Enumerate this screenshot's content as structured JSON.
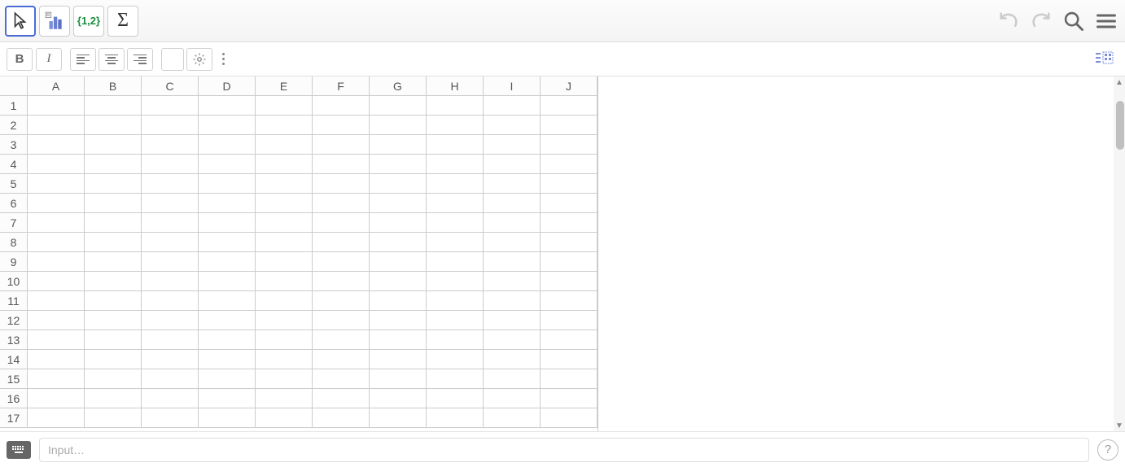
{
  "toolbar": {
    "tools": {
      "move": "move-tool",
      "chart": "chart-tool",
      "list": "{1,2}",
      "sum": "Σ"
    }
  },
  "format": {
    "bold": "B",
    "italic": "I"
  },
  "spreadsheet": {
    "columns": [
      "A",
      "B",
      "C",
      "D",
      "E",
      "F",
      "G",
      "H",
      "I",
      "J"
    ],
    "rows": [
      "1",
      "2",
      "3",
      "4",
      "5",
      "6",
      "7",
      "8",
      "9",
      "10",
      "11",
      "12",
      "13",
      "14",
      "15",
      "16",
      "17"
    ]
  },
  "input": {
    "placeholder": "Input…"
  },
  "help": {
    "label": "?"
  }
}
